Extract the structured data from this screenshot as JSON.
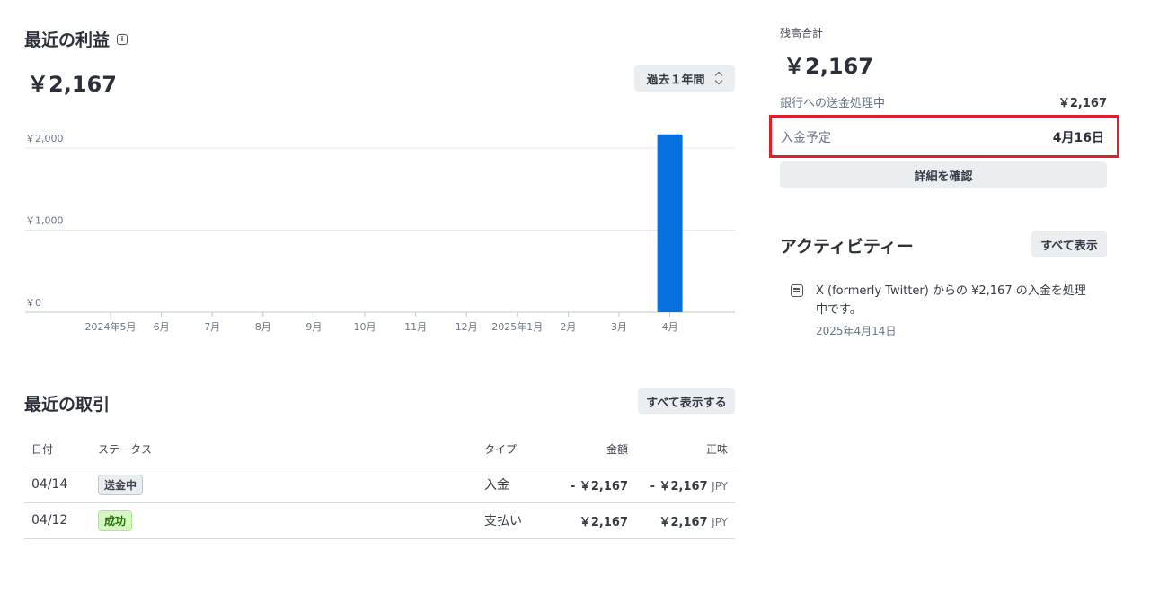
{
  "earnings": {
    "title": "最近の利益",
    "total": "￥2,167",
    "period": "過去１年間"
  },
  "chart_data": {
    "type": "bar",
    "categories": [
      "2024年5月",
      "6月",
      "7月",
      "8月",
      "9月",
      "10月",
      "11月",
      "12月",
      "2025年1月",
      "2月",
      "3月",
      "4月"
    ],
    "values": [
      0,
      0,
      0,
      0,
      0,
      0,
      0,
      0,
      0,
      0,
      0,
      2167
    ],
    "y_ticks": [
      {
        "value": 0,
        "label": "￥0"
      },
      {
        "value": 1000,
        "label": "￥1,000"
      },
      {
        "value": 2000,
        "label": "￥2,000"
      }
    ],
    "ylim": [
      0,
      2300
    ],
    "bar_color": "#0570de",
    "grid": true
  },
  "transactions": {
    "title": "最近の取引",
    "view_all": "すべて表示する",
    "headers": {
      "date": "日付",
      "status": "ステータス",
      "type": "タイプ",
      "amount": "金額",
      "net": "正味"
    },
    "rows": [
      {
        "date": "04/14",
        "status": "送金中",
        "type": "入金",
        "amount": "- ￥2,167",
        "net": "- ￥2,167",
        "currency": "JPY"
      },
      {
        "date": "04/12",
        "status": "成功",
        "type": "支払い",
        "amount": "￥2,167",
        "net": "￥2,167",
        "currency": "JPY"
      }
    ]
  },
  "balance": {
    "label": "残高合計",
    "total": "￥2,167",
    "bank_label": "銀行への送金処理中",
    "bank_value": "￥2,167",
    "deposit_label": "入金予定",
    "deposit_value": "4月16日",
    "details_button": "詳細を確認",
    "highlight_color": "#e01e2d"
  },
  "activity": {
    "title": "アクティビティー",
    "view_all": "すべて表示",
    "items": [
      {
        "text": "X (formerly Twitter) からの ¥2,167 の入金を処理中です。",
        "date": "2025年4月14日",
        "icon": "document-icon"
      }
    ]
  }
}
